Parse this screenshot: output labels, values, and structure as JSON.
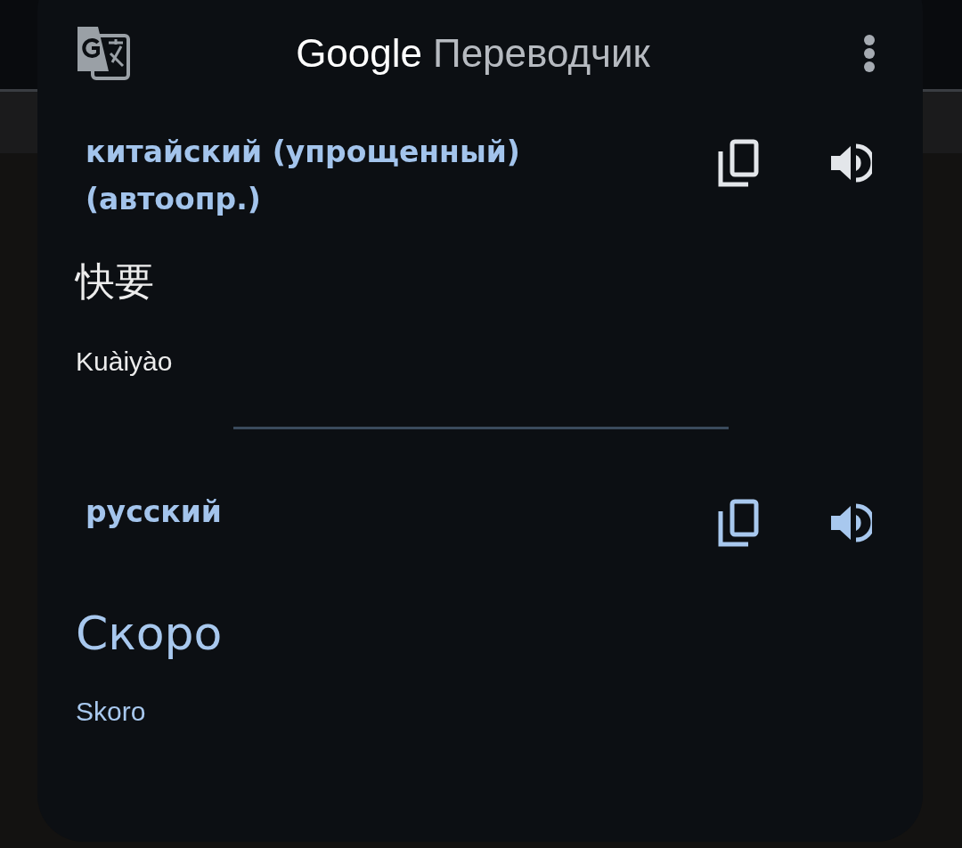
{
  "header": {
    "brand": "Google",
    "product": "Переводчик"
  },
  "panels": [
    {
      "kind": "source",
      "language": "китайский (упрощенный) (автоопр.)",
      "text": "快要",
      "transliteration": "Kuàiyào"
    },
    {
      "kind": "target",
      "language": "русский",
      "text": "Скоро",
      "transliteration": "Skoro"
    }
  ]
}
